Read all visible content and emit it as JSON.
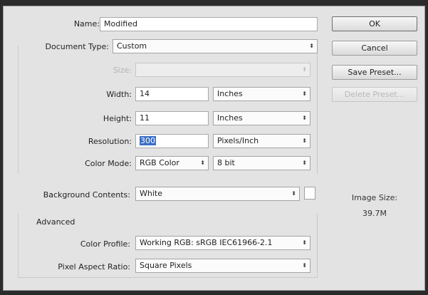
{
  "form": {
    "name": {
      "label": "Name:",
      "value": "Modified"
    },
    "document_type": {
      "label": "Document Type:",
      "value": "Custom"
    },
    "size": {
      "label": "Size:",
      "value": ""
    },
    "width": {
      "label": "Width:",
      "value": "14",
      "unit": "Inches"
    },
    "height": {
      "label": "Height:",
      "value": "11",
      "unit": "Inches"
    },
    "resolution": {
      "label": "Resolution:",
      "value": "300",
      "unit": "Pixels/Inch"
    },
    "color_mode": {
      "label": "Color Mode:",
      "value": "RGB Color",
      "bit_depth": "8 bit"
    },
    "background": {
      "label": "Background Contents:",
      "value": "White"
    },
    "advanced": {
      "title": "Advanced",
      "color_profile": {
        "label": "Color Profile:",
        "value": "Working RGB:  sRGB IEC61966-2.1"
      },
      "pixel_aspect": {
        "label": "Pixel Aspect Ratio:",
        "value": "Square Pixels"
      }
    }
  },
  "buttons": {
    "ok": "OK",
    "cancel": "Cancel",
    "save_preset": "Save Preset...",
    "delete_preset": "Delete Preset..."
  },
  "image_size": {
    "label": "Image Size:",
    "value": "39.7M"
  },
  "colors": {
    "dialog_bg": "#e3e3e3",
    "selection": "#3c6fc4",
    "background_swatch": "#ffffff"
  }
}
